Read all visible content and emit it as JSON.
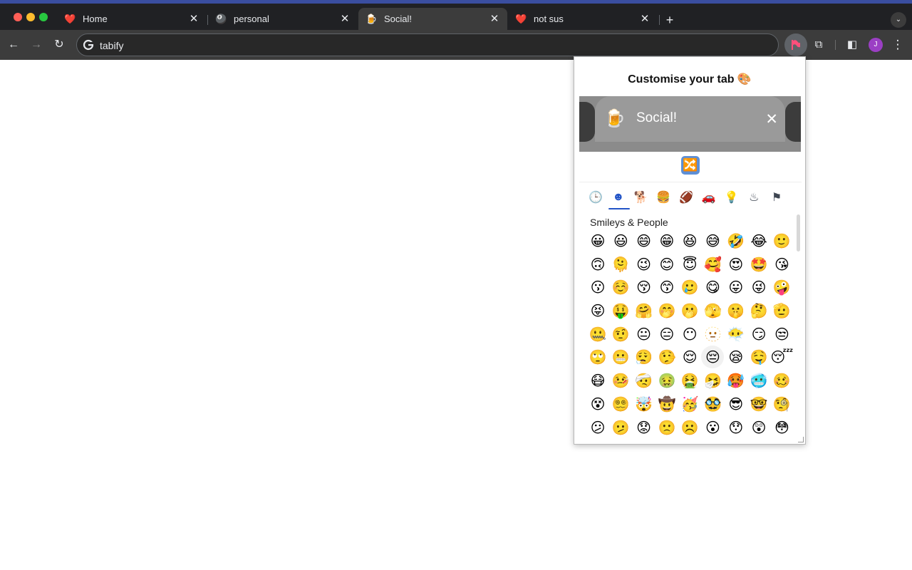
{
  "window": {
    "traffic_colors": [
      "#ff5f57",
      "#febc2e",
      "#28c840"
    ]
  },
  "tabs": [
    {
      "favicon": "❤️",
      "title": "Home",
      "close": "✕"
    },
    {
      "favicon": "🎱",
      "title": "personal",
      "close": "✕"
    },
    {
      "favicon": "🍺",
      "title": "Social!",
      "close": "✕",
      "active": true
    },
    {
      "favicon": "❤️",
      "title": "not sus",
      "close": "✕"
    }
  ],
  "tabbar": {
    "new_tab": "+",
    "tab_search": "⌄"
  },
  "toolbar": {
    "back": "←",
    "forward": "→",
    "reload": "↻",
    "url": "tabify",
    "extensions": "⧉",
    "sidepanel": "◧",
    "profile_initial": "J",
    "menu": "⋮"
  },
  "popup": {
    "title": "Customise your tab 🎨",
    "preview": {
      "emoji": "🍺",
      "title": "Social!",
      "close": "✕"
    },
    "shuffle": "🔀",
    "categories": [
      {
        "icon": "clock-icon",
        "glyph": "🕒"
      },
      {
        "icon": "smiley-icon",
        "glyph": "☻",
        "active": true
      },
      {
        "icon": "dog-icon",
        "glyph": "🐕"
      },
      {
        "icon": "burger-icon",
        "glyph": "🍔"
      },
      {
        "icon": "ball-icon",
        "glyph": "🏈"
      },
      {
        "icon": "car-icon",
        "glyph": "🚗"
      },
      {
        "icon": "bulb-icon",
        "glyph": "💡"
      },
      {
        "icon": "symbols-icon",
        "glyph": "♨"
      },
      {
        "icon": "flag-icon",
        "glyph": "⚑"
      }
    ],
    "section_label": "Smileys & People",
    "emojis": [
      "😀",
      "😃",
      "😄",
      "😁",
      "😆",
      "😅",
      "🤣",
      "😂",
      "🙂",
      "🙃",
      "🫠",
      "😉",
      "😊",
      "😇",
      "🥰",
      "😍",
      "🤩",
      "😘",
      "😗",
      "☺️",
      "😚",
      "😙",
      "🥲",
      "😋",
      "😛",
      "😜",
      "🤪",
      "😝",
      "🤑",
      "🤗",
      "🤭",
      "🫢",
      "🫣",
      "🤫",
      "🤔",
      "🫡",
      "🤐",
      "🤨",
      "😐",
      "😑",
      "😶",
      "🫥",
      "😶‍🌫️",
      "😏",
      "😒",
      "🙄",
      "😬",
      "😮‍💨",
      "🤥",
      "😌",
      "😔",
      "😪",
      "🤤",
      "😴",
      "😷",
      "🤒",
      "🤕",
      "🤢",
      "🤮",
      "🤧",
      "🥵",
      "🥶",
      "🥴",
      "😵",
      "😵‍💫",
      "🤯",
      "🤠",
      "🥳",
      "🥸",
      "😎",
      "🤓",
      "🧐",
      "😕",
      "🫤",
      "😟",
      "🙁",
      "☹️",
      "😮",
      "😯",
      "😲",
      "😳"
    ],
    "hover_index": 50
  }
}
